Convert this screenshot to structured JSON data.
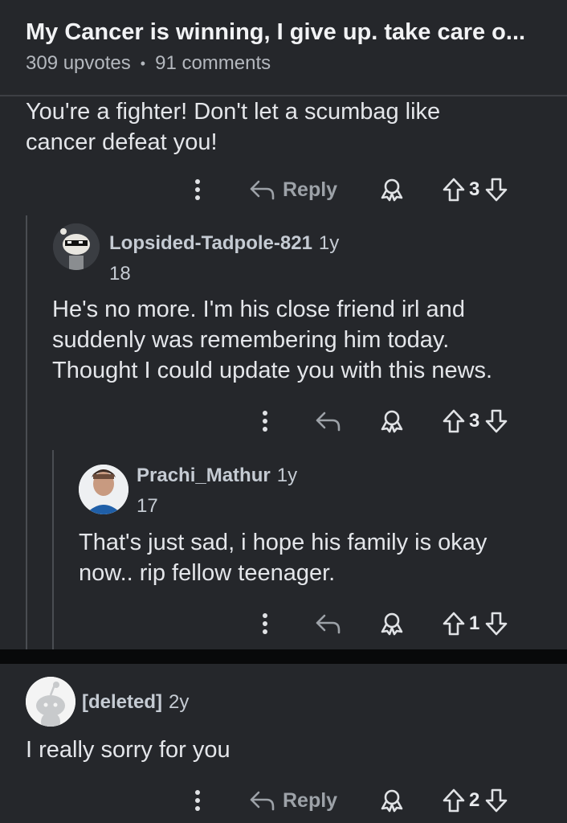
{
  "post": {
    "title": "My Cancer is winning, I give up. take care o...",
    "upvotes": "309 upvotes",
    "separator": "•",
    "comments": "91 comments"
  },
  "comments": [
    {
      "text": "You're a fighter! Don't let a scumbag like cancer defeat you!",
      "line1": "You're a fighter! Don't let a scumbag like",
      "line2": "cancer defeat you!",
      "reply_label": "Reply",
      "votes": "3"
    },
    {
      "username": "Lopsided-Tadpole-821",
      "age": "1y",
      "score": "18",
      "line1": "He's no more. I'm his close friend irl and",
      "line2": "suddenly was remembering him today.",
      "line3": "Thought I could update you with this news.",
      "votes": "3"
    },
    {
      "username": "Prachi_Mathur",
      "age": "1y",
      "score": "17",
      "line1": "That's just sad, i hope his family is okay",
      "line2": "now.. rip fellow teenager.",
      "votes": "1"
    },
    {
      "username": "[deleted]",
      "age": "2y",
      "line1": "I really sorry for you",
      "reply_label": "Reply",
      "votes": "2"
    }
  ],
  "icons": [
    "more-options-icon",
    "reply-icon",
    "award-icon",
    "upvote-icon",
    "downvote-icon"
  ]
}
